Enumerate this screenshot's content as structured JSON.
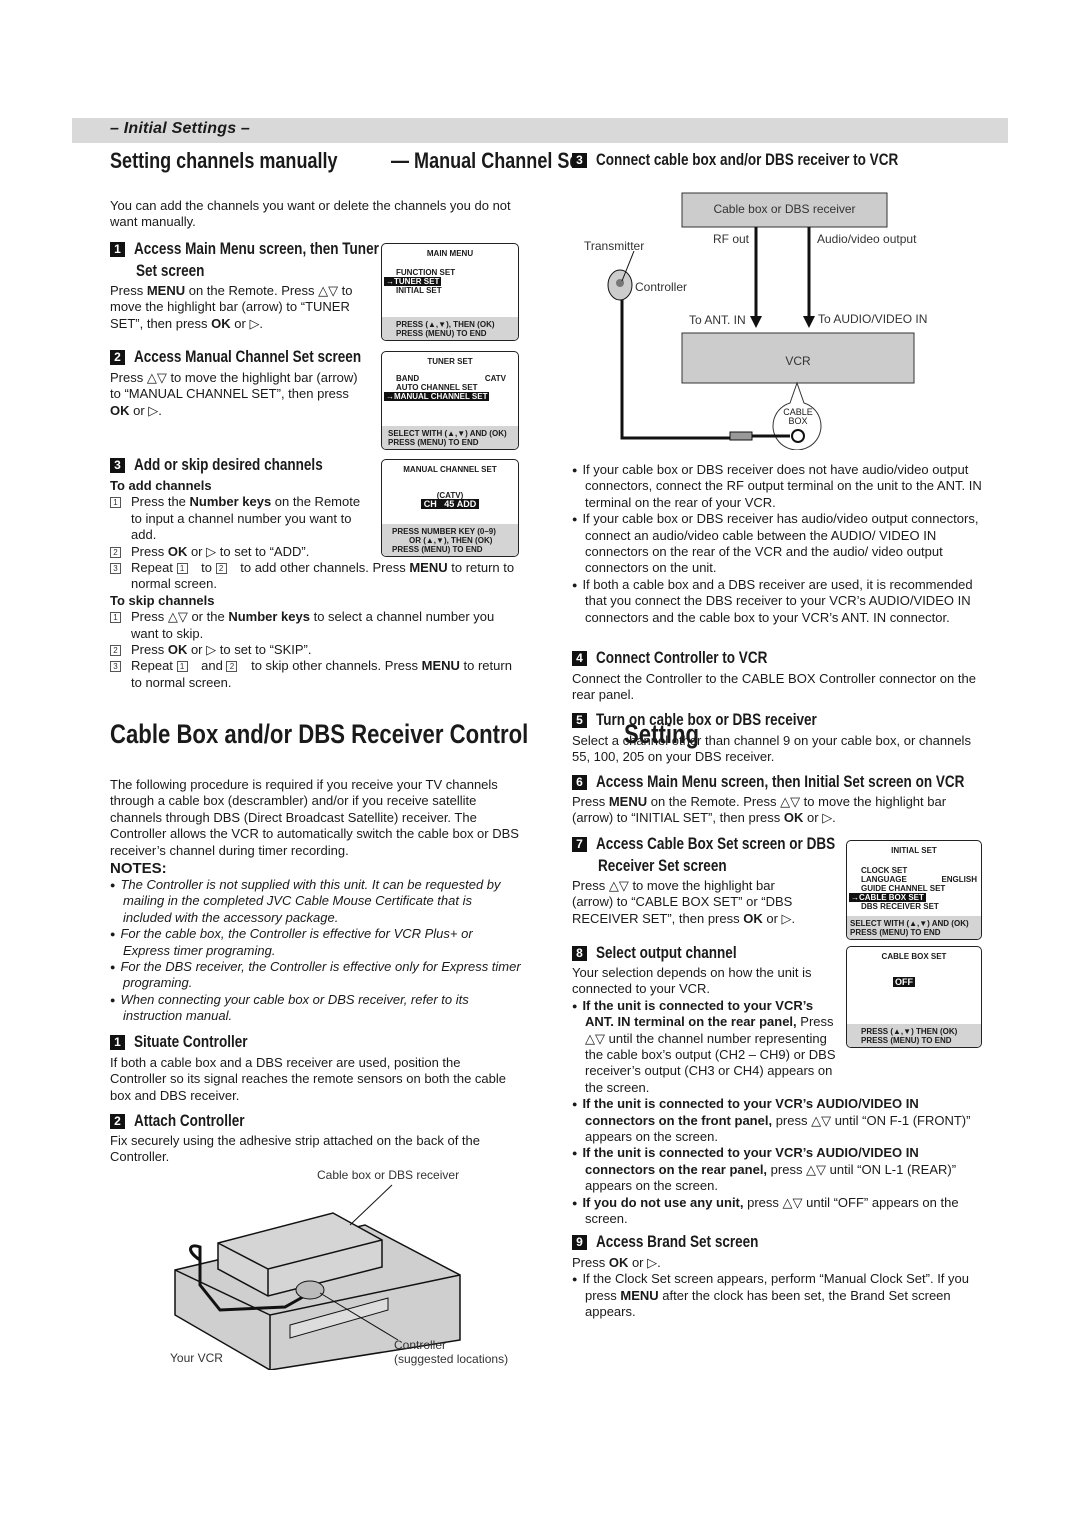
{
  "header": {
    "section": "– Initial Settings –"
  },
  "manual": {
    "title1": "Setting channels manually",
    "title2": "— Manual Channel Set",
    "intro": "You can add the channels you want or delete the channels you do not want manually.",
    "step1": {
      "num": "1",
      "title1": "Access Main Menu screen, then Tuner",
      "title2": "Set screen",
      "body": [
        {
          "t": "Press "
        },
        {
          "t": "MENU",
          "b": 1
        },
        {
          "t": " on the Remote. Press △▽ to move the highlight bar (arrow) to “TUNER SET”, then press "
        },
        {
          "t": "OK",
          "b": 1
        },
        {
          "t": " or ▷."
        }
      ]
    },
    "step2": {
      "num": "2",
      "title": "Access Manual Channel Set screen",
      "body": [
        {
          "t": "Press △▽ to move the highlight bar (arrow) to “MANUAL CHANNEL SET”, then press "
        },
        {
          "t": "OK",
          "b": 1
        },
        {
          "t": " or ▷."
        }
      ]
    },
    "step3": {
      "num": "3",
      "title": "Add or skip desired channels",
      "add_title": "To add channels",
      "add_items": [
        {
          "n": "1",
          "seg": [
            {
              "t": "Press the "
            },
            {
              "t": "Number keys",
              "b": 1
            },
            {
              "t": " on the Remote to input a channel number you want to add."
            }
          ]
        },
        {
          "n": "2",
          "seg": [
            {
              "t": "Press "
            },
            {
              "t": "OK",
              "b": 1
            },
            {
              "t": " or ▷ to set to “ADD”."
            }
          ]
        },
        {
          "n": "3",
          "seg": [
            {
              "t": "Repeat "
            },
            {
              "t": "1",
              "sq": 1
            },
            {
              "t": " to "
            },
            {
              "t": "2",
              "sq": 1
            },
            {
              "t": " to add other channels. Press "
            },
            {
              "t": "MENU",
              "b": 1
            },
            {
              "t": " to return to normal screen."
            }
          ]
        }
      ],
      "skip_title": "To skip channels",
      "skip_items": [
        {
          "n": "1",
          "seg": [
            {
              "t": "Press △▽ or the "
            },
            {
              "t": "Number keys",
              "b": 1
            },
            {
              "t": " to select a channel number you want to skip."
            }
          ]
        },
        {
          "n": "2",
          "seg": [
            {
              "t": "Press "
            },
            {
              "t": "OK",
              "b": 1
            },
            {
              "t": " or ▷ to set to “SKIP”."
            }
          ]
        },
        {
          "n": "3",
          "seg": [
            {
              "t": "Repeat "
            },
            {
              "t": "1",
              "sq": 1
            },
            {
              "t": " and "
            },
            {
              "t": "2",
              "sq": 1
            },
            {
              "t": " to skip other channels. Press "
            },
            {
              "t": "MENU",
              "b": 1
            },
            {
              "t": " to return to normal screen."
            }
          ]
        }
      ]
    }
  },
  "screens": {
    "main_menu": {
      "title": "MAIN MENU",
      "lines": [
        "FUNCTION SET",
        "→TUNER SET",
        "INITIAL SET"
      ],
      "highlight": 1,
      "footer": [
        "PRESS (▲,▼), THEN (OK)",
        "PRESS (MENU) TO END"
      ]
    },
    "tuner_set": {
      "title": "TUNER SET",
      "band_label": "BAND",
      "band_value": "CATV",
      "lines": [
        "AUTO CHANNEL SET",
        "→MANUAL CHANNEL SET"
      ],
      "footer": [
        "SELECT WITH (▲,▼) AND (OK)",
        "PRESS (MENU) TO END"
      ]
    },
    "manual_channel": {
      "title": "MANUAL CHANNEL SET",
      "band": "(CATV)",
      "ch_label": "CH",
      "ch_value": "45",
      "status": "ADD",
      "footer": [
        "PRESS NUMBER KEY (0–9)",
        "OR (▲,▼), THEN (OK)",
        "PRESS (MENU) TO END"
      ]
    },
    "initial_set": {
      "title": "INITIAL SET",
      "lines": [
        "CLOCK SET",
        "LANGUAGE",
        "GUIDE CHANNEL SET",
        "→CABLE BOX SET",
        "DBS RECEIVER SET"
      ],
      "language_value": "ENGLISH",
      "footer": [
        "SELECT WITH (▲,▼) AND (OK)",
        "PRESS (MENU) TO END"
      ]
    },
    "cable_box_set": {
      "title": "CABLE BOX SET",
      "value": "OFF",
      "footer": [
        "PRESS (▲,▼) THEN (OK)",
        "PRESS (MENU) TO END"
      ]
    }
  },
  "cable": {
    "title1": "Cable Box and/or DBS Receiver Control",
    "title2": "Setting",
    "intro": "The following procedure is required if you receive your TV channels through a cable box (descrambler) and/or if you receive satellite channels through DBS (Direct Broadcast Satellite) receiver. The Controller allows the VCR to automatically switch the cable box or DBS receiver’s channel during timer recording.",
    "notes_title": "NOTES:",
    "notes": [
      "The Controller is not supplied with this unit. It can be requested by mailing in the completed JVC Cable Mouse Certificate that is included with the accessory package.",
      "For the cable box, the Controller is effective for VCR Plus+ or Express timer programing.",
      "For the DBS receiver, the Controller is effective only for Express timer programing.",
      "When connecting your cable box or DBS receiver, refer to its instruction manual."
    ],
    "step1": {
      "num": "1",
      "title": "Situate Controller",
      "body": "If both a cable box and a DBS receiver are used, position the Controller so its signal reaches the remote sensors on both the cable box and DBS receiver."
    },
    "step2": {
      "num": "2",
      "title": "Attach Controller",
      "body": "Fix securely using the adhesive strip attached on the back of the Controller."
    },
    "illustration": {
      "cable_box": "Cable box or DBS receiver",
      "vcr": "Your VCR",
      "controller1": "Controller",
      "controller2": "(suggested locations)"
    },
    "step3": {
      "num": "3",
      "title": "Connect cable box and/or DBS receiver to VCR"
    },
    "diagram": {
      "cable_box": "Cable box or DBS receiver",
      "rf_out": "RF out",
      "av_out": "Audio/video output",
      "transmitter": "Transmitter",
      "controller": "Controller",
      "to_ant": "To ANT. IN",
      "to_av": "To AUDIO/VIDEO IN",
      "vcr": "VCR",
      "jack1": "CABLE",
      "jack2": "BOX"
    },
    "step3_bullets": [
      "If your cable box or DBS receiver does not have audio/video output connectors, connect the RF output terminal on the unit to the ANT. IN terminal on the rear of your VCR.",
      "If your cable box or DBS receiver has audio/video output connectors, connect an audio/video cable between the AUDIO/ VIDEO IN connectors on the rear of the VCR and the audio/ video output connectors on the unit.",
      "If both a cable box and a DBS receiver are used, it is recommended that you connect the DBS receiver to your VCR’s AUDIO/VIDEO IN connectors and the cable box to your VCR’s ANT. IN connector."
    ],
    "step4": {
      "num": "4",
      "title": "Connect Controller to VCR",
      "body": "Connect the Controller to the CABLE BOX Controller connector on the rear panel."
    },
    "step5": {
      "num": "5",
      "title": "Turn on cable box or DBS receiver",
      "body": "Select a channel other than channel 9 on your cable box, or channels 55, 100, 205 on your DBS receiver."
    },
    "step6": {
      "num": "6",
      "title": "Access Main Menu screen, then Initial Set screen on VCR",
      "body": [
        {
          "t": "Press "
        },
        {
          "t": "MENU",
          "b": 1
        },
        {
          "t": " on the Remote. Press △▽ to move the highlight bar (arrow) to “INITIAL SET”, then press "
        },
        {
          "t": "OK",
          "b": 1
        },
        {
          "t": " or ▷."
        }
      ]
    },
    "step7": {
      "num": "7",
      "title1": "Access Cable Box Set screen or DBS",
      "title2": "Receiver Set screen",
      "body": [
        {
          "t": "Press △▽ to move the highlight bar (arrow) to “CABLE BOX SET” or “DBS RECEIVER SET”, then press "
        },
        {
          "t": "OK",
          "b": 1
        },
        {
          "t": " or ▷."
        }
      ]
    },
    "step8": {
      "num": "8",
      "title": "Select output channel",
      "body": "Your selection depends on how the unit is connected to your VCR.",
      "bullets": [
        [
          {
            "t": "If the unit is connected to your VCR’s ANT. IN terminal on the rear panel,",
            "b": 1
          },
          {
            "t": " Press △▽ until the channel number representing the cable box’s output (CH2 – CH9) or DBS receiver’s output (CH3 or CH4) appears on the screen."
          }
        ],
        [
          {
            "t": "If the unit is connected to your VCR’s AUDIO/VIDEO IN connectors on the front panel,",
            "b": 1
          },
          {
            "t": " press △▽ until “ON F-1 (FRONT)” appears on the screen."
          }
        ],
        [
          {
            "t": "If the unit is connected to your VCR’s AUDIO/VIDEO IN connectors on the rear panel,",
            "b": 1
          },
          {
            "t": " press △▽ until “ON L-1 (REAR)” appears on the screen."
          }
        ],
        [
          {
            "t": "If you do not use any unit,",
            "b": 1
          },
          {
            "t": " press △▽ until “OFF” appears on the screen."
          }
        ]
      ]
    },
    "step9": {
      "num": "9",
      "title": "Access Brand Set screen",
      "body": [
        {
          "t": "Press "
        },
        {
          "t": "OK",
          "b": 1
        },
        {
          "t": " or ▷."
        }
      ],
      "bullets": [
        [
          {
            "t": "If the Clock Set screen appears, perform “Manual Clock Set”. If you press "
          },
          {
            "t": "MENU",
            "b": 1
          },
          {
            "t": " after the clock has been set, the Brand Set screen appears."
          }
        ]
      ]
    }
  },
  "colors": {
    "header_bar": "#d9d9d9",
    "screen_footer": "#d4d4d4",
    "diagram_box": "#cccccc"
  }
}
